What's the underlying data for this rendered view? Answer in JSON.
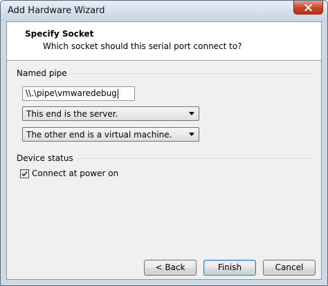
{
  "window": {
    "title": "Add Hardware Wizard"
  },
  "header": {
    "title": "Specify Socket",
    "subtitle": "Which socket should this serial port connect to?"
  },
  "named_pipe": {
    "group_label": "Named pipe",
    "pipe_path_value": "\\\\.\\pipe\\vmwaredebug",
    "end_select_value": "This end is the server.",
    "other_end_select_value": "The other end is a virtual machine."
  },
  "device_status": {
    "group_label": "Device status",
    "connect_at_power_on_label": "Connect at power on",
    "connect_at_power_on_checked": true
  },
  "buttons": {
    "back_label": "< Back",
    "finish_label": "Finish",
    "cancel_label": "Cancel"
  },
  "colors": {
    "close_button": "#c6432b",
    "default_button_border": "#3c7fb1"
  },
  "icons": {
    "close": "close-icon",
    "dropdown": "chevron-down-icon",
    "check": "checkmark-icon"
  }
}
